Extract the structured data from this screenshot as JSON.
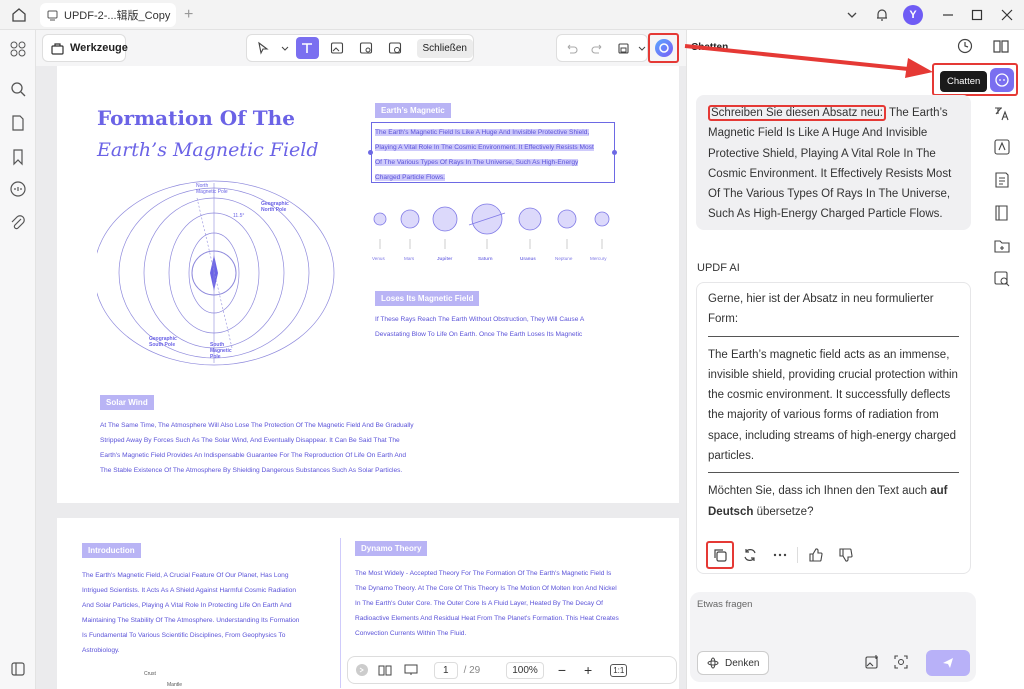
{
  "app": {
    "tab_title": "UPDF-2-...辑版_Copy",
    "avatar_letter": "Y"
  },
  "toolbar": {
    "tools_label": "Werkzeuge",
    "close_label": "Schließen"
  },
  "document": {
    "title_line1": "Formation Of The",
    "title_line2": "Earth’s Magnetic Field",
    "diagram_labels": {
      "north_magnetic": "North\nMagnetic Pole",
      "geographic_north": "Geographic\nNorth Pole",
      "geographic_south": "Geographic\nSouth Pole",
      "south_magnetic": "South\nMagnetic\nPole",
      "angle": "11.5°"
    },
    "earths_magnetic_label": "Earth’s Magnetic",
    "earths_magnetic_lines": [
      "The Earth's Magnetic Field Is Like A Huge And Invisible Protective Shield,",
      "Playing A Vital Role In The Cosmic Environment. It Effectively Resists Most",
      "Of The Various Types Of Rays In The Universe, Such As High-Energy",
      "Charged Particle Flows."
    ],
    "planets": [
      "Venus",
      "Mars",
      "Jupiter",
      "Saturn",
      "Uranus",
      "Neptune",
      "Mercury"
    ],
    "loses_label": "Loses Its Magnetic Field",
    "loses_lines": [
      "If These Rays Reach The Earth Without Obstruction, They Will Cause A",
      "Devastating Blow To Life On Earth. Once The Earth Loses Its Magnetic"
    ],
    "solar_label": "Solar Wind",
    "solar_lines": [
      "At The Same Time, The Atmosphere Will Also Lose The Protection Of The Magnetic Field And Be Gradually",
      "Stripped Away By Forces Such As The Solar Wind, And Eventually Disappear. It Can Be Said That The",
      "Earth's Magnetic Field Provides An Indispensable Guarantee For The Reproduction Of Life On Earth And",
      "The Stable Existence Of The Atmosphere By Shielding Dangerous Substances Such As Solar Particles."
    ],
    "intro_label": "Introduction",
    "intro_lines": [
      "The Earth's Magnetic Field, A Crucial Feature Of Our Planet, Has Long",
      "Intrigued Scientists. It Acts As A Shield Against Harmful Cosmic Radiation",
      "And Solar Particles, Playing A Vital Role In Protecting Life On Earth And",
      "Maintaining The Stability Of The Atmosphere. Understanding Its Formation",
      "Is Fundamental To Various Scientific Disciplines, From Geophysics To",
      "Astrobiology."
    ],
    "dynamo_label": "Dynamo Theory",
    "dynamo_lines": [
      "The Most Widely - Accepted Theory For The Formation Of The Earth's Magnetic Field Is",
      "The Dynamo Theory. At The Core Of This Theory Is The Motion Of Molten Iron And Nickel",
      "In The Earth's Outer Core. The Outer Core Is A Fluid Layer, Heated By The Decay Of",
      "Radioactive Elements And Residual Heat From The Planet's Formation. This Heat Creates",
      "Convection Currents Within The Fluid."
    ],
    "bottom_snippet": [
      "Crust",
      "Mantle"
    ]
  },
  "pager": {
    "current_page": "1",
    "total_pages": "/ 29",
    "zoom": "100%",
    "fit": "1:1"
  },
  "chat": {
    "panel_title": "Chatten",
    "tooltip": "Chatten",
    "user_prefix": "Schreiben Sie diesen Absatz neu:",
    "user_body": " The Earth’s Magnetic Field Is Like A Huge And Invisible Protective Shield, Playing A Vital Role In The Cosmic Environment. It Effectively Resists Most Of The Various Types Of Rays In The Universe, Such As High-Energy Charged Particle Flows.",
    "ai_label": "UPDF AI",
    "ai_intro": "Gerne, hier ist der Absatz in neu formulierter Form:",
    "ai_body": "The Earth’s magnetic field acts as an immense, invisible shield, providing crucial protection within the cosmic environment. It successfully deflects the majority of various forms of radiation from space, including streams of high-energy charged particles.",
    "ai_question_prefix": "Möchten Sie, dass ich Ihnen den Text auch ",
    "ai_question_bold": "auf Deutsch",
    "ai_question_suffix": " übersetze?",
    "input_placeholder": "Etwas fragen",
    "think_label": "Denken"
  },
  "colors": {
    "accent": "#6b63e6",
    "highlight_red": "#e53935"
  }
}
